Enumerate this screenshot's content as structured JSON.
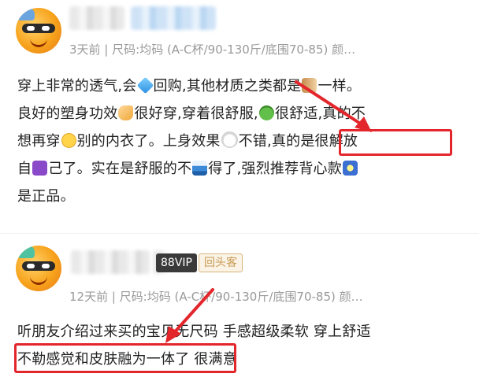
{
  "reviews": [
    {
      "meta": "3天前 | 尺码:均码   (A-C杯/90-130斤/底围70-85) 颜…",
      "lines": [
        [
          "穿上非常的透气,会",
          "diamond-emoji",
          "回购,其他材质之类都是",
          "skewer-emoji",
          "一样。"
        ],
        [
          "良好的塑身功效",
          "pointing-hand-emoji",
          "很好穿,穿着很舒服,",
          "frog-emoji",
          "很舒适,真的不"
        ],
        [
          "想再穿",
          "hushed-face-emoji",
          "别的内衣了。上身效果",
          "cloud-emoji",
          "不错,",
          "真的是很解放"
        ],
        [
          "自",
          "zodiac-emoji",
          "己了。实在是舒服的不",
          "wave-emoji",
          "得了,强烈推荐背心款",
          "star-emoji"
        ],
        [
          "是正品。"
        ]
      ]
    },
    {
      "vip": "88VIP",
      "badge": "回头客",
      "meta": "12天前 | 尺码:均码   (A-C杯/90-130斤/底围70-85) 颜…",
      "lines": [
        [
          "听朋友介绍过来买的宝贝无尺码 手感超级柔软 穿上舒适"
        ],
        [
          "不勒感觉和皮肤融为一体了",
          " 很满意"
        ]
      ]
    }
  ],
  "colors": {
    "highlight": "#e3262b",
    "meta": "#9a9a9a",
    "text": "#222222"
  }
}
